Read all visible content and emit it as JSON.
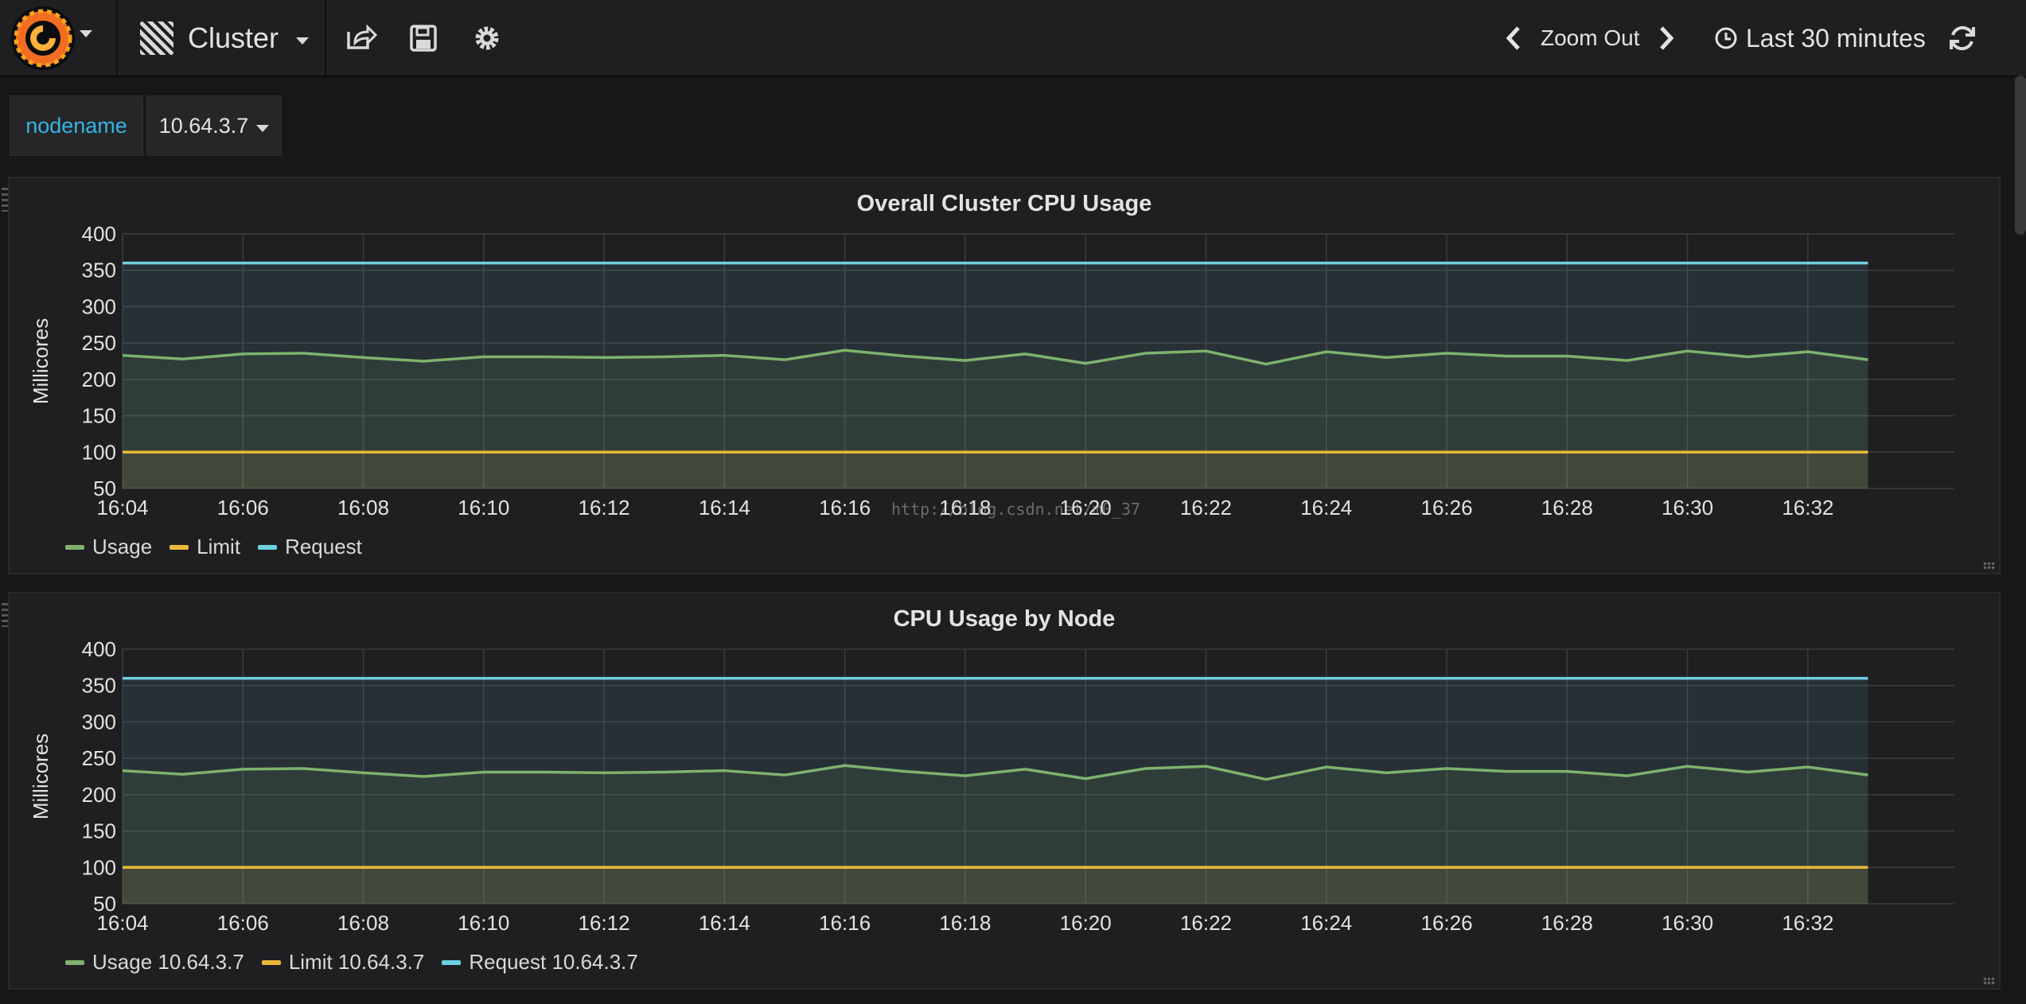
{
  "navbar": {
    "dashboard_title": "Cluster",
    "zoom_out_label": "Zoom Out",
    "time_range_label": "Last 30 minutes",
    "icons": [
      "grafana-logo-icon",
      "grid-icon",
      "share-icon",
      "save-icon",
      "gear-icon",
      "chevron-left-icon",
      "chevron-right-icon",
      "clock-icon",
      "refresh-icon"
    ]
  },
  "variables": {
    "name": "nodename",
    "value": "10.64.3.7"
  },
  "watermark": "http://blog.csdn.net/m0_37",
  "colors": {
    "usage": "#7eb26d",
    "limit": "#eab839",
    "request": "#6ed0e0",
    "accent": "#33b5e5"
  },
  "chart_data": [
    {
      "type": "area",
      "title": "Overall Cluster CPU Usage",
      "xlabel": "",
      "ylabel": "Millicores",
      "ylim": [
        50,
        400
      ],
      "yticks": [
        400,
        350,
        300,
        250,
        200,
        150,
        100,
        50
      ],
      "xticks": [
        "16:04",
        "16:06",
        "16:08",
        "16:10",
        "16:12",
        "16:14",
        "16:16",
        "16:18",
        "16:20",
        "16:22",
        "16:24",
        "16:26",
        "16:28",
        "16:30",
        "16:32"
      ],
      "x": [
        "16:04",
        "16:05",
        "16:06",
        "16:07",
        "16:08",
        "16:09",
        "16:10",
        "16:11",
        "16:12",
        "16:13",
        "16:14",
        "16:15",
        "16:16",
        "16:17",
        "16:18",
        "16:19",
        "16:20",
        "16:21",
        "16:22",
        "16:23",
        "16:24",
        "16:25",
        "16:26",
        "16:27",
        "16:28",
        "16:29",
        "16:30",
        "16:31",
        "16:32",
        "16:33"
      ],
      "grid": true,
      "legend_position": "bottom-left",
      "series": [
        {
          "name": "Usage",
          "color": "#7eb26d",
          "values": [
            233,
            228,
            235,
            236,
            230,
            225,
            231,
            231,
            230,
            231,
            233,
            227,
            240,
            232,
            226,
            235,
            222,
            236,
            239,
            221,
            238,
            230,
            236,
            232,
            232,
            226,
            239,
            231,
            238,
            227
          ]
        },
        {
          "name": "Limit",
          "color": "#eab839",
          "values": [
            100,
            100,
            100,
            100,
            100,
            100,
            100,
            100,
            100,
            100,
            100,
            100,
            100,
            100,
            100,
            100,
            100,
            100,
            100,
            100,
            100,
            100,
            100,
            100,
            100,
            100,
            100,
            100,
            100,
            100
          ]
        },
        {
          "name": "Request",
          "color": "#6ed0e0",
          "values": [
            360,
            360,
            360,
            360,
            360,
            360,
            360,
            360,
            360,
            360,
            360,
            360,
            360,
            360,
            360,
            360,
            360,
            360,
            360,
            360,
            360,
            360,
            360,
            360,
            360,
            360,
            360,
            360,
            360,
            360
          ]
        }
      ]
    },
    {
      "type": "area",
      "title": "CPU Usage by Node",
      "xlabel": "",
      "ylabel": "Millicores",
      "ylim": [
        50,
        400
      ],
      "yticks": [
        400,
        350,
        300,
        250,
        200,
        150,
        100,
        50
      ],
      "xticks": [
        "16:04",
        "16:06",
        "16:08",
        "16:10",
        "16:12",
        "16:14",
        "16:16",
        "16:18",
        "16:20",
        "16:22",
        "16:24",
        "16:26",
        "16:28",
        "16:30",
        "16:32"
      ],
      "x": [
        "16:04",
        "16:05",
        "16:06",
        "16:07",
        "16:08",
        "16:09",
        "16:10",
        "16:11",
        "16:12",
        "16:13",
        "16:14",
        "16:15",
        "16:16",
        "16:17",
        "16:18",
        "16:19",
        "16:20",
        "16:21",
        "16:22",
        "16:23",
        "16:24",
        "16:25",
        "16:26",
        "16:27",
        "16:28",
        "16:29",
        "16:30",
        "16:31",
        "16:32",
        "16:33"
      ],
      "grid": true,
      "legend_position": "bottom-left",
      "series": [
        {
          "name": "Usage 10.64.3.7",
          "color": "#7eb26d",
          "values": [
            233,
            228,
            235,
            236,
            230,
            225,
            231,
            231,
            230,
            231,
            233,
            227,
            240,
            232,
            226,
            235,
            222,
            236,
            239,
            221,
            238,
            230,
            236,
            232,
            232,
            226,
            239,
            231,
            238,
            227
          ]
        },
        {
          "name": "Limit 10.64.3.7",
          "color": "#eab839",
          "values": [
            100,
            100,
            100,
            100,
            100,
            100,
            100,
            100,
            100,
            100,
            100,
            100,
            100,
            100,
            100,
            100,
            100,
            100,
            100,
            100,
            100,
            100,
            100,
            100,
            100,
            100,
            100,
            100,
            100,
            100
          ]
        },
        {
          "name": "Request 10.64.3.7",
          "color": "#6ed0e0",
          "values": [
            360,
            360,
            360,
            360,
            360,
            360,
            360,
            360,
            360,
            360,
            360,
            360,
            360,
            360,
            360,
            360,
            360,
            360,
            360,
            360,
            360,
            360,
            360,
            360,
            360,
            360,
            360,
            360,
            360,
            360
          ]
        }
      ]
    }
  ]
}
